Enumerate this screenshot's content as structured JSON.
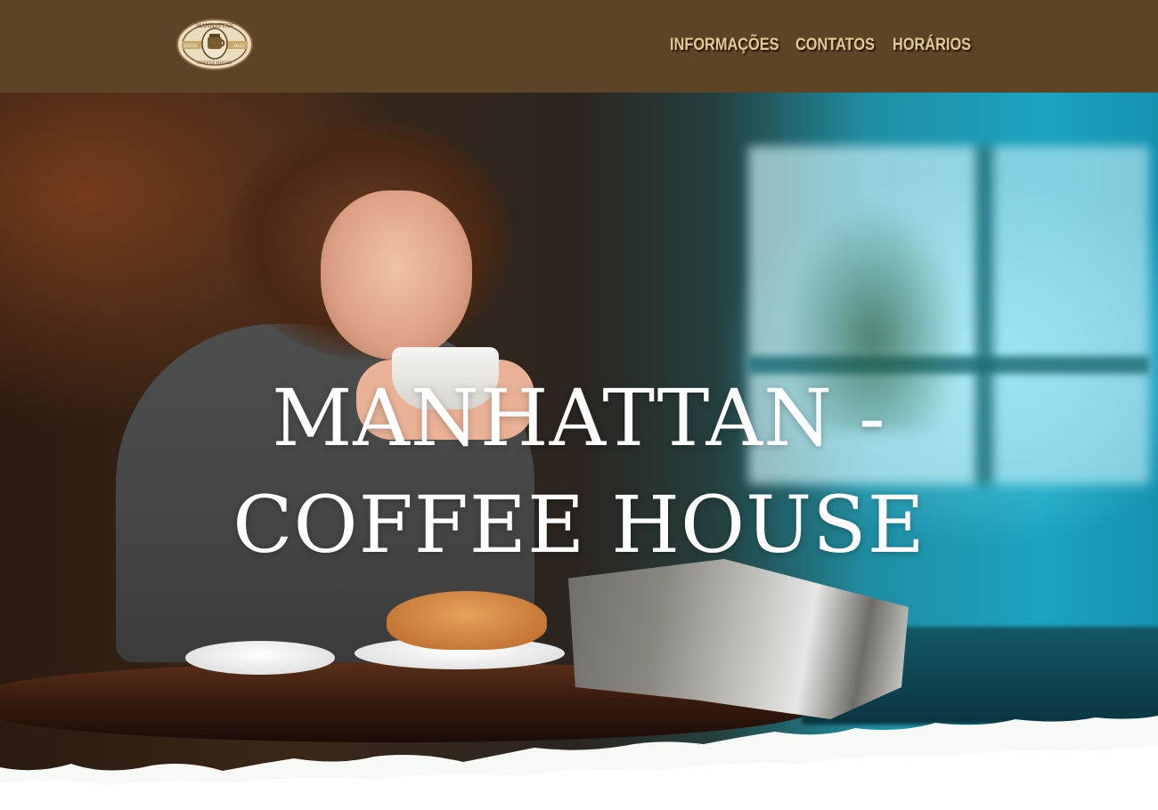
{
  "header": {
    "logo": {
      "text_top": "MANHATTAN",
      "text_left": "ESTD",
      "text_right": "2022",
      "text_bottom": "COFFEE HOUSE"
    },
    "nav": [
      {
        "label": "INFORMAÇÕES"
      },
      {
        "label": "CONTATOS"
      },
      {
        "label": "HORÁRIOS"
      }
    ]
  },
  "hero": {
    "title": "MANHATTAN - COFFEE HOUSE"
  },
  "colors": {
    "header_bg": "#5e4426",
    "nav_text": "#e4c893",
    "title_text": "#ffffff",
    "brush_white": "#f7f9f6"
  }
}
